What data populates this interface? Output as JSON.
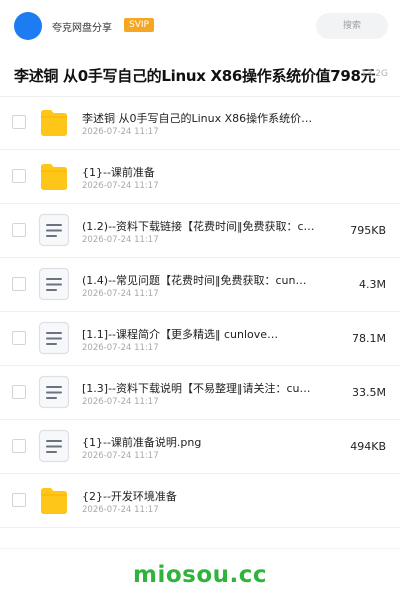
{
  "header": {
    "share_label": "夸克网盘分享",
    "vip_badge": "SVIP",
    "search_placeholder": "搜索"
  },
  "folder": {
    "title": "李述铜 从0手写自己的Linux X86操作系统价值798元",
    "total_size": "13.2G"
  },
  "files": [
    {
      "kind": "folder",
      "name": "李述铜 从0手写自己的Linux X86操作系统价…",
      "date": "2026-07-24 11:17",
      "size": ""
    },
    {
      "kind": "folder",
      "name": "{1}--课前准备",
      "date": "2026-07-24 11:17",
      "size": ""
    },
    {
      "kind": "doc",
      "name": "(1.2)--资料下载链接【花费时间‖免费获取：c…",
      "date": "2026-07-24 11:17",
      "size": "795KB"
    },
    {
      "kind": "doc",
      "name": "(1.4)--常见问题【花费时间‖免费获取：cun…",
      "date": "2026-07-24 11:17",
      "size": "4.3M"
    },
    {
      "kind": "doc",
      "name": "[1.1]--课程简介【更多精选‖ cunlove…",
      "date": "2026-07-24 11:17",
      "size": "78.1M"
    },
    {
      "kind": "doc",
      "name": "[1.3]--资料下载说明【不易整理‖请关注：cu…",
      "date": "2026-07-24 11:17",
      "size": "33.5M"
    },
    {
      "kind": "doc",
      "name": "{1}--课前准备说明.png",
      "date": "2026-07-24 11:17",
      "size": "494KB"
    },
    {
      "kind": "folder",
      "name": "{2}--开发环境准备",
      "date": "2026-07-24 11:17",
      "size": ""
    }
  ],
  "watermark": "miosou.cc",
  "colors": {
    "accent": "#1e7cf2",
    "vip": "#f5a623",
    "folder": "#ffc61a",
    "watermark": "#2fb33a"
  }
}
